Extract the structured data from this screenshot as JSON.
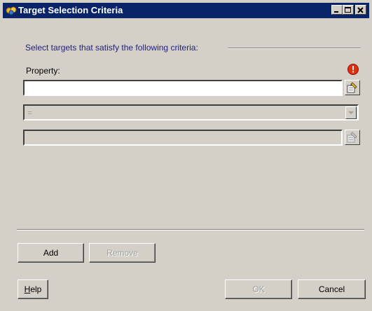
{
  "window": {
    "title": "Target Selection Criteria",
    "colors": {
      "titlebar": "#0a246a",
      "face": "#d4d0c8",
      "group_label": "#22227a"
    }
  },
  "criteria": {
    "header": "Select targets that satisfy the following criteria:",
    "property_label": "Property:",
    "property_value": "",
    "operator_value": "=",
    "value_field": ""
  },
  "buttons": {
    "add": "Add",
    "remove": "Remove",
    "help_key": "H",
    "help_rest": "elp",
    "ok": "OK",
    "cancel": "Cancel"
  },
  "icons": {
    "app": "target-app-icon",
    "error": "error-icon",
    "property_picker": "browse-picker-icon",
    "value_picker": "browse-picker-icon"
  }
}
